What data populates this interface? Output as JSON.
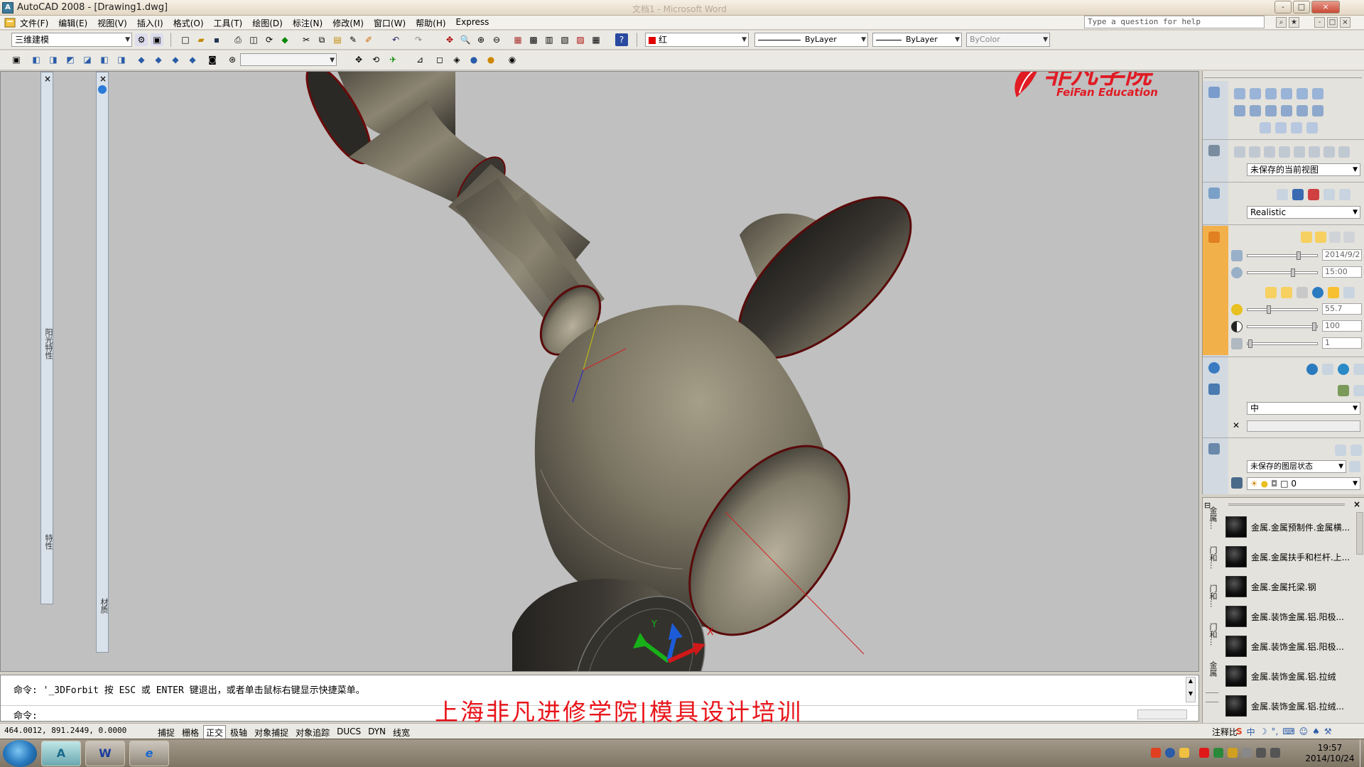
{
  "window": {
    "title": "AutoCAD 2008 - [Drawing1.dwg]",
    "background_title": "文档1 - Microsoft Word",
    "controls": [
      "-",
      "□",
      "×"
    ],
    "doc_controls": [
      "-",
      "□",
      "×"
    ]
  },
  "menu": {
    "items": [
      "文件(F)",
      "编辑(E)",
      "视图(V)",
      "插入(I)",
      "格式(O)",
      "工具(T)",
      "绘图(D)",
      "标注(N)",
      "修改(M)",
      "窗口(W)",
      "帮助(H)",
      "Express"
    ],
    "help_placeholder": "Type a question for help"
  },
  "toolbar1": {
    "workspace": "三维建模",
    "color": "红",
    "color_swatch": "#e00000",
    "linetype": "ByLayer",
    "lineweight": "ByLayer",
    "plotstyle": "ByColor"
  },
  "toolbar2": {
    "view_combo": ""
  },
  "logo": {
    "brand_cn": "非凡学院",
    "brand_en": "FeiFan Education",
    "color": "#e01b24"
  },
  "viewport": {
    "background": "#c0c0c0",
    "left_panel_labels": [
      "阳光特性",
      "特性"
    ],
    "mid_panel_label": "材质",
    "ucs_labels": [
      "Y",
      "X"
    ]
  },
  "dashboard": {
    "view_combo": "未保存的当前视图",
    "visual_style": "Realistic",
    "date_value": "2014/9/2",
    "time_value": "15:00",
    "intensity_value": "55.7",
    "contrast_value": "100",
    "fade_value": "1",
    "render_quality": "中",
    "layer_state": "未保存的图层状态",
    "layer_current": "0"
  },
  "materials": {
    "tabs": [
      "金属...",
      "门和...",
      "门和...",
      "门和...",
      "金属"
    ],
    "items": [
      "金属.金属预制件.金属横...",
      "金属.金属扶手和栏杆.上...",
      "金属.金属托梁.钢",
      "金属.装饰金属.铝.阳极...",
      "金属.装饰金属.铝.阳极...",
      "金属.装饰金属.铝.拉绒",
      "金属.装饰金属.铝.拉绒..."
    ]
  },
  "command": {
    "line1": "命令: '_3DForbit 按 ESC 或 ENTER 键退出，或者单击鼠标右键显示快捷菜单。",
    "line2": "命令:",
    "watermark": "上海非凡进修学院|模具设计培训"
  },
  "status": {
    "coords": "464.0012,  891.2449, 0.0000",
    "toggles": [
      "捕捉",
      "栅格",
      "正交",
      "极轴",
      "对象捕捉",
      "对象追踪",
      "DUCS",
      "DYN",
      "线宽"
    ],
    "active_toggle": "正交",
    "annotation_label": "注释比"
  },
  "taskbar": {
    "apps": [
      "A",
      "W",
      "e"
    ],
    "time": "19:57",
    "date": "2014/10/24"
  }
}
